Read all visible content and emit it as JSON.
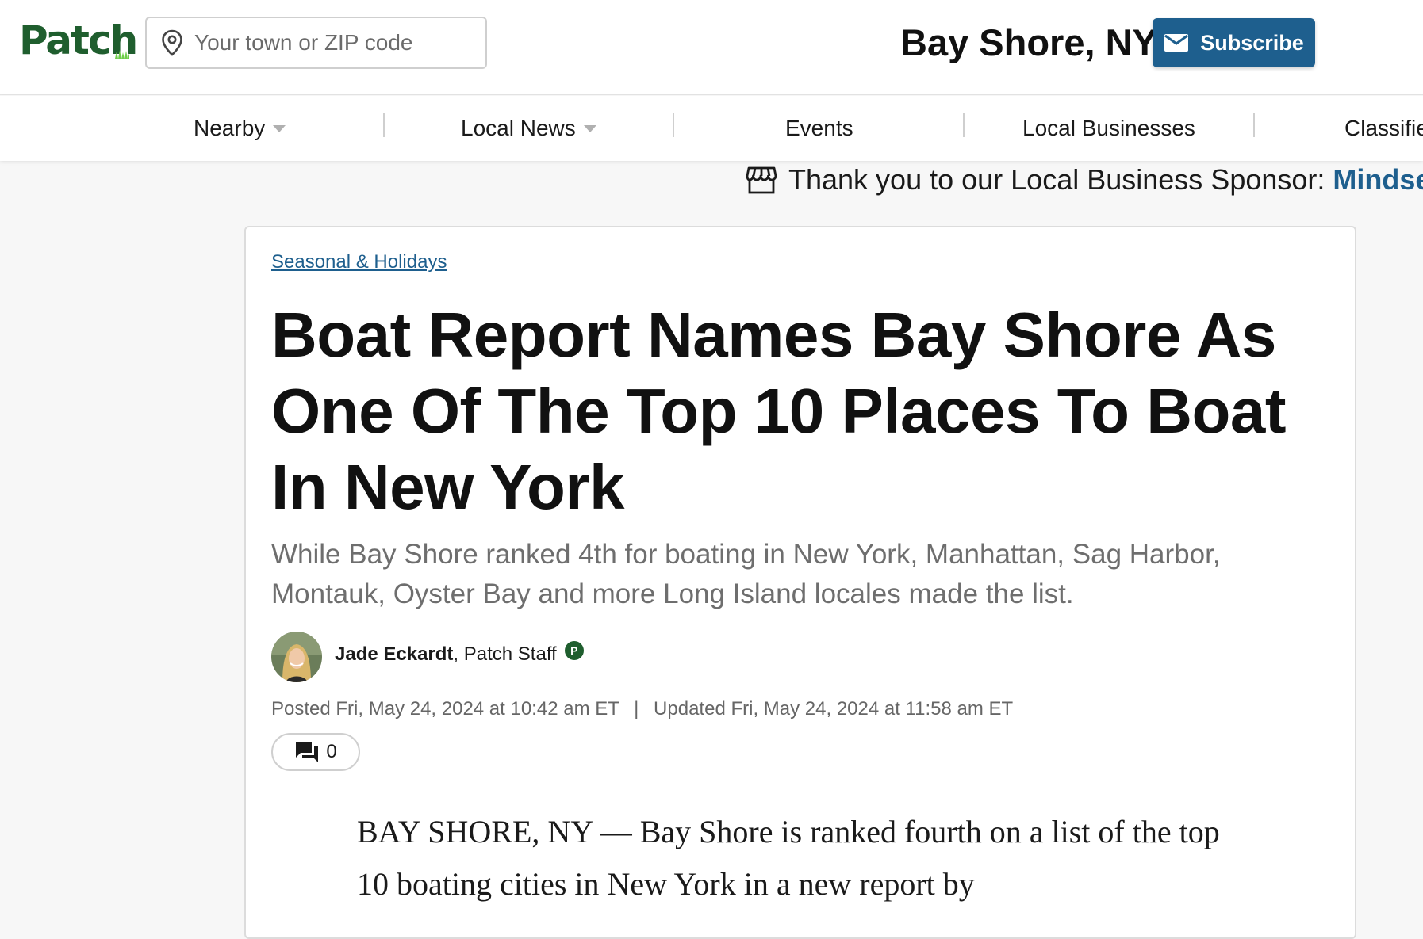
{
  "header": {
    "logo_text": "Patch",
    "search": {
      "placeholder": "Your town or ZIP code",
      "value": ""
    },
    "town": "Bay Shore, NY",
    "subscribe_label": "Subscribe",
    "colors": {
      "brand_green": "#1f5e2e",
      "accent_blue": "#1e5f8e"
    }
  },
  "nav": {
    "items": [
      {
        "label": "Nearby",
        "has_dropdown": true
      },
      {
        "label": "Local News",
        "has_dropdown": true
      },
      {
        "label": "Events",
        "has_dropdown": false
      },
      {
        "label": "Local Businesses",
        "has_dropdown": false
      },
      {
        "label": "Classifie",
        "has_dropdown": false
      }
    ]
  },
  "sponsor": {
    "icon": "storefront-icon",
    "prefix": "Thank you to our Local Business Sponsor:",
    "name": "Mindse"
  },
  "article": {
    "category": "Seasonal & Holidays",
    "headline": "Boat Report Names Bay Shore As One Of The Top 10 Places To Boat In New York",
    "subhead": "While Bay Shore ranked 4th for boating in New York, Manhattan, Sag Harbor, Montauk, Oyster Bay and more Long Island locales made the list.",
    "author": {
      "name": "Jade Eckardt",
      "role": ", Patch Staff",
      "badge": "P"
    },
    "posted": "Posted Fri, May 24, 2024 at 10:42 am ET",
    "date_separator": "|",
    "updated": "Updated Fri, May 24, 2024 at 11:58 am ET",
    "comment_count": "0",
    "body_first": "BAY SHORE, NY — Bay Shore is ranked fourth on a list of the top 10 boating cities in New York in a new report by"
  }
}
